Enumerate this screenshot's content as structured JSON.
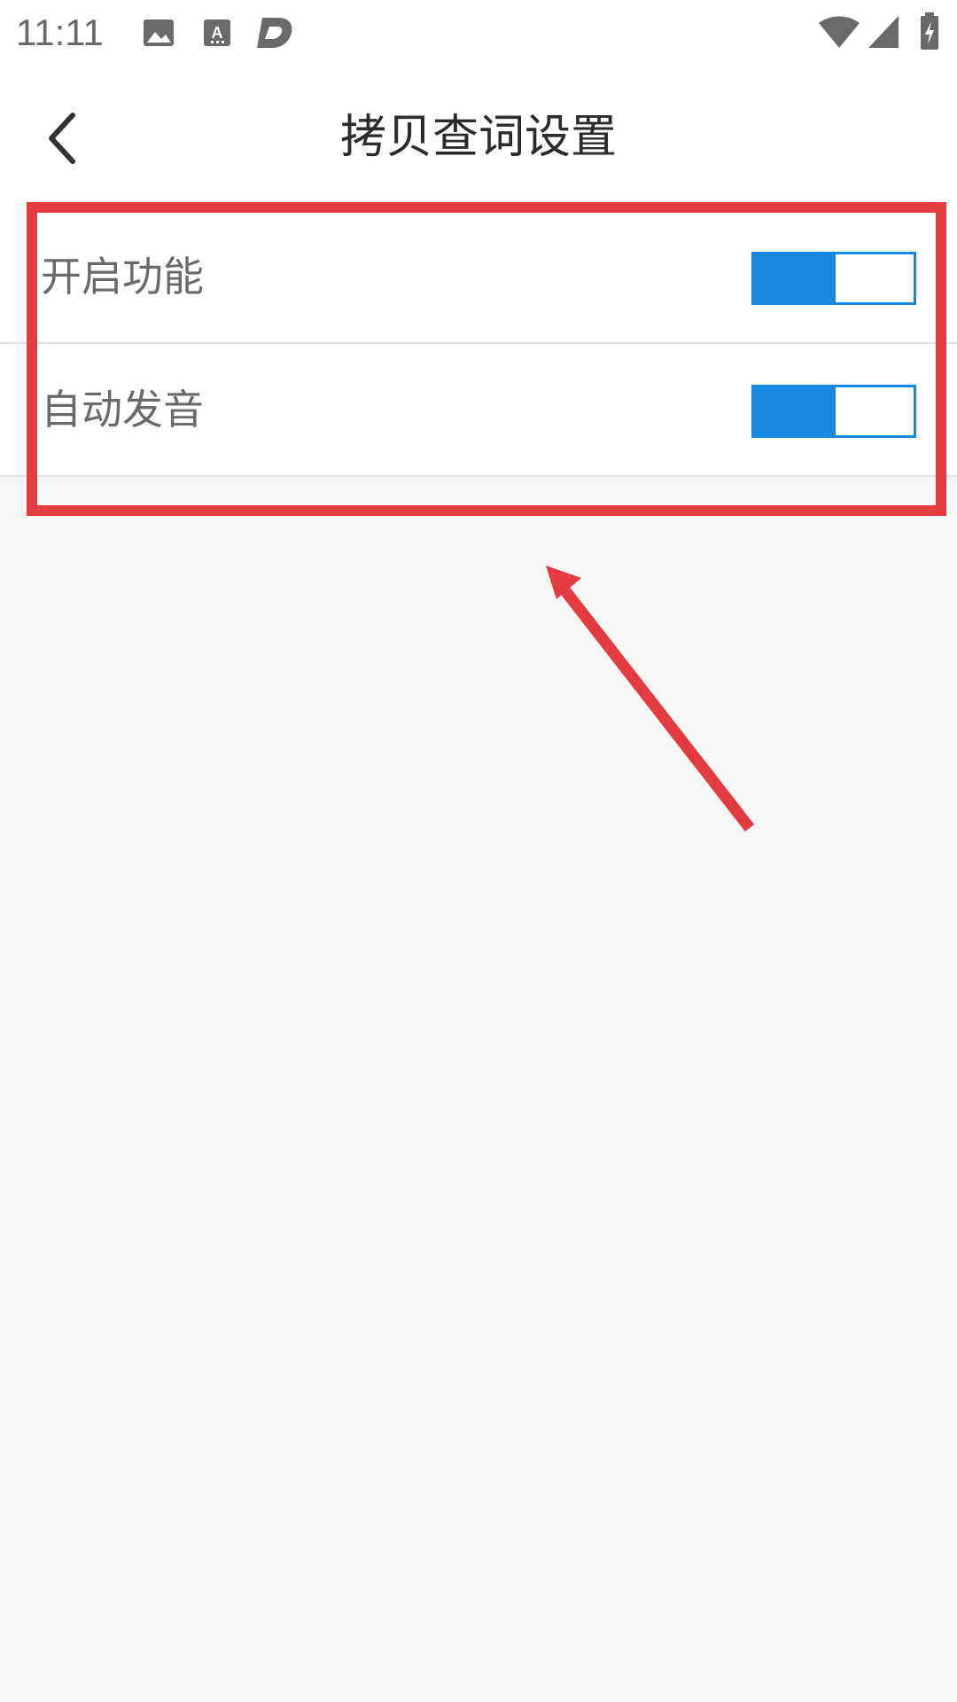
{
  "status_bar": {
    "time": "11:11",
    "left_icons": [
      "image-icon",
      "text-recognition-icon",
      "d-app-icon"
    ],
    "right_icons": [
      "wifi-icon",
      "cellular-signal-icon",
      "battery-charging-icon"
    ]
  },
  "header": {
    "back_icon": "chevron-left-icon",
    "title": "拷贝查词设置"
  },
  "settings": [
    {
      "label": "开启功能",
      "enabled": true
    },
    {
      "label": "自动发音",
      "enabled": true
    }
  ],
  "colors": {
    "accent": "#1888e0",
    "annotation": "#e33b3f",
    "background": "#f6f6f7"
  }
}
